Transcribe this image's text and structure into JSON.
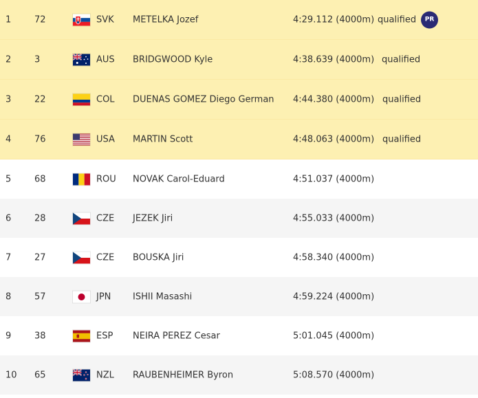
{
  "rows": [
    {
      "rank": "1",
      "bib": "72",
      "flag": "svk-flag-icon",
      "noc": "SVK",
      "name": "METELKA Jozef",
      "time": "4:29.112 (4000m)",
      "status": "qualified",
      "badge": "PR"
    },
    {
      "rank": "2",
      "bib": "3",
      "flag": "aus-flag-icon",
      "noc": "AUS",
      "name": "BRIDGWOOD Kyle",
      "time": "4:38.639 (4000m)",
      "status": "qualified",
      "badge": ""
    },
    {
      "rank": "3",
      "bib": "22",
      "flag": "col-flag-icon",
      "noc": "COL",
      "name": "DUENAS GOMEZ Diego German",
      "time": "4:44.380 (4000m)",
      "status": "qualified",
      "badge": ""
    },
    {
      "rank": "4",
      "bib": "76",
      "flag": "usa-flag-icon",
      "noc": "USA",
      "name": "MARTIN Scott",
      "time": "4:48.063 (4000m)",
      "status": "qualified",
      "badge": ""
    },
    {
      "rank": "5",
      "bib": "68",
      "flag": "rou-flag-icon",
      "noc": "ROU",
      "name": "NOVAK Carol-Eduard",
      "time": "4:51.037 (4000m)",
      "status": "",
      "badge": ""
    },
    {
      "rank": "6",
      "bib": "28",
      "flag": "cze-flag-icon",
      "noc": "CZE",
      "name": "JEZEK Jiri",
      "time": "4:55.033 (4000m)",
      "status": "",
      "badge": ""
    },
    {
      "rank": "7",
      "bib": "27",
      "flag": "cze-flag-icon",
      "noc": "CZE",
      "name": "BOUSKA Jiri",
      "time": "4:58.340 (4000m)",
      "status": "",
      "badge": ""
    },
    {
      "rank": "8",
      "bib": "57",
      "flag": "jpn-flag-icon",
      "noc": "JPN",
      "name": "ISHII Masashi",
      "time": "4:59.224 (4000m)",
      "status": "",
      "badge": ""
    },
    {
      "rank": "9",
      "bib": "38",
      "flag": "esp-flag-icon",
      "noc": "ESP",
      "name": "NEIRA PEREZ Cesar",
      "time": "5:01.045 (4000m)",
      "status": "",
      "badge": ""
    },
    {
      "rank": "10",
      "bib": "65",
      "flag": "nzl-flag-icon",
      "noc": "NZL",
      "name": "RAUBENHEIMER Byron",
      "time": "5:08.570 (4000m)",
      "status": "",
      "badge": ""
    }
  ],
  "colors": {
    "qualified_row_bg": "#fdf0b2",
    "alt_row_bg": "#f5f5f5",
    "pr_badge_bg": "#2a2a74"
  }
}
